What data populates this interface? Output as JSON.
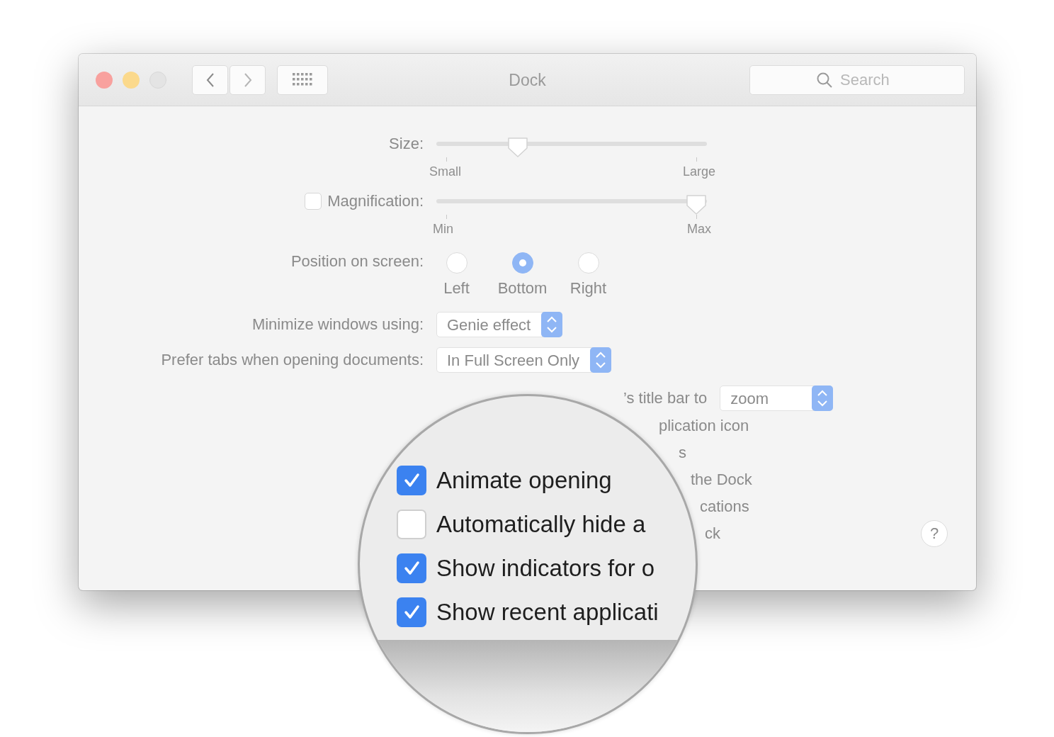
{
  "window": {
    "title": "Dock"
  },
  "toolbar": {
    "search": {
      "placeholder": "Search"
    }
  },
  "size": {
    "label": "Size:",
    "level": 0.3,
    "min_label": "Small",
    "max_label": "Large"
  },
  "magnification": {
    "label": "Magnification:",
    "checked": false,
    "level": 0.96,
    "min_label": "Min",
    "max_label": "Max"
  },
  "position": {
    "label": "Position on screen:",
    "options": [
      {
        "label": "Left",
        "selected": false
      },
      {
        "label": "Bottom",
        "selected": true
      },
      {
        "label": "Right",
        "selected": false
      }
    ]
  },
  "minimize": {
    "label": "Minimize windows using:",
    "value": "Genie effect"
  },
  "prefer_tabs": {
    "label": "Prefer tabs when opening documents:",
    "value": "In Full Screen Only"
  },
  "partial_rows": [
    {
      "text": "’s title bar to",
      "popup": "zoom"
    },
    {
      "text": "plication icon"
    },
    {
      "text": "s"
    },
    {
      "text": "the Dock"
    },
    {
      "text": "cations"
    },
    {
      "text": "ck"
    }
  ],
  "magnifier": {
    "rows": [
      {
        "text": "Animate opening",
        "checked": true
      },
      {
        "text": "Automatically hide a",
        "checked": false
      },
      {
        "text": "Show indicators for o",
        "checked": true
      },
      {
        "text": "Show recent applicati",
        "checked": true
      }
    ]
  },
  "help": "?"
}
